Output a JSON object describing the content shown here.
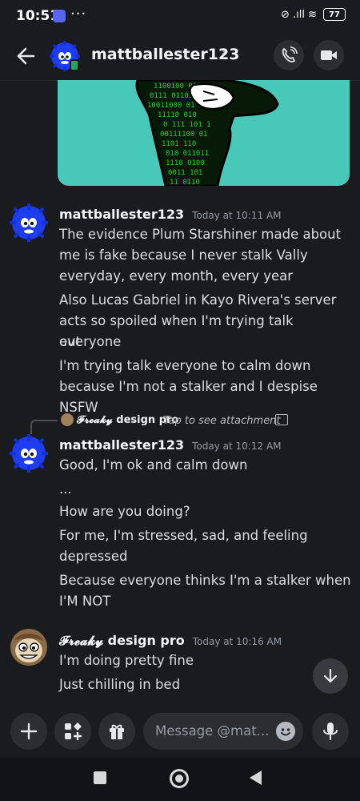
{
  "status_bar": {
    "time": "10:51",
    "more": "···",
    "signal_icons": "⊘ .ıll ≋",
    "battery": "77"
  },
  "header": {
    "name": "mattballester123",
    "chevron": "›"
  },
  "messages": [
    {
      "author": "mattballester123",
      "timestamp": "Today at 10:11 AM",
      "lines": [
        "The evidence Plum Starshiner made about",
        "me is fake because I never stalk Vally",
        "everyday, every month, every year",
        "Also Lucas Gabriel in Kayo Rivera's server",
        "acts so spoiled when I'm trying talk everyone",
        "out",
        "I'm trying talk everyone to calm down",
        "because I'm not a stalker and I despise NSFW"
      ]
    },
    {
      "author": "mattballester123",
      "timestamp": "Today at 10:12 AM",
      "reply": {
        "author_prefix": "𝓕𝓻𝓮𝓪𝓴𝔂",
        "author": "design pro",
        "text": "Tap to see attachment"
      },
      "lines": [
        "Good, I'm ok and calm down",
        "...",
        "How are you doing?",
        "For me, I'm stressed, sad, and feeling",
        "depressed",
        "Because everyone thinks I'm a stalker when",
        "I'M NOT"
      ]
    },
    {
      "author_prefix": "𝓕𝓻𝓮𝓪𝓴𝔂",
      "author": "design pro",
      "timestamp": "Today at 10:16 AM",
      "lines": [
        "I'm doing pretty fine",
        "Just chilling in bed"
      ]
    }
  ],
  "composer": {
    "placeholder": "Message @mat..."
  },
  "icons": {
    "back": "back-arrow-icon",
    "call": "phone-icon",
    "video": "video-camera-icon",
    "plus": "plus-icon",
    "apps": "apps-icon",
    "gift": "gift-icon",
    "emoji": "emoji-icon",
    "mic": "microphone-icon",
    "scroll": "arrow-down-icon"
  },
  "colors": {
    "background": "#1a1b1f",
    "accent": "#5865f2",
    "image_bg": "#48c8b9",
    "online": "#23a55a"
  }
}
